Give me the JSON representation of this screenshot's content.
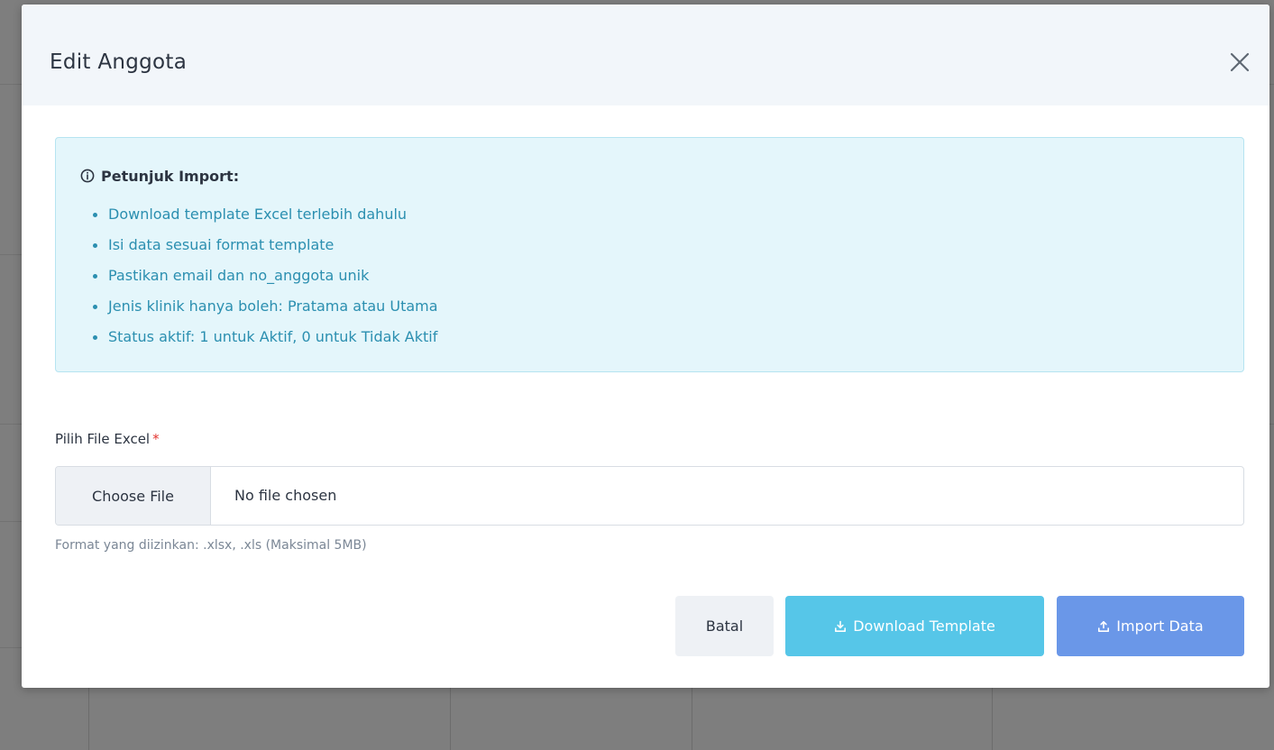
{
  "modal": {
    "title": "Edit Anggota",
    "close_label": "×"
  },
  "alert": {
    "heading": "Petunjuk Import:",
    "items": [
      "Download template Excel terlebih dahulu",
      "Isi data sesuai format template",
      "Pastikan email dan no_anggota unik",
      "Jenis klinik hanya boleh: Pratama atau Utama",
      "Status aktif: 1 untuk Aktif, 0 untuk Tidak Aktif"
    ]
  },
  "form": {
    "label": "Pilih File Excel",
    "required_mark": "*",
    "choose_button": "Choose File",
    "file_status": "No file chosen",
    "help": "Format yang diizinkan: .xlsx, .xls (Maksimal 5MB)"
  },
  "buttons": {
    "cancel": "Batal",
    "download": "Download Template",
    "import": "Import Data"
  },
  "colors": {
    "header_bg": "#f2f6fa",
    "alert_bg": "#e4f6fb",
    "alert_text": "#2b8fb0",
    "download_btn": "#56c6e8",
    "import_btn": "#6a97e8",
    "required": "#e3342f"
  }
}
